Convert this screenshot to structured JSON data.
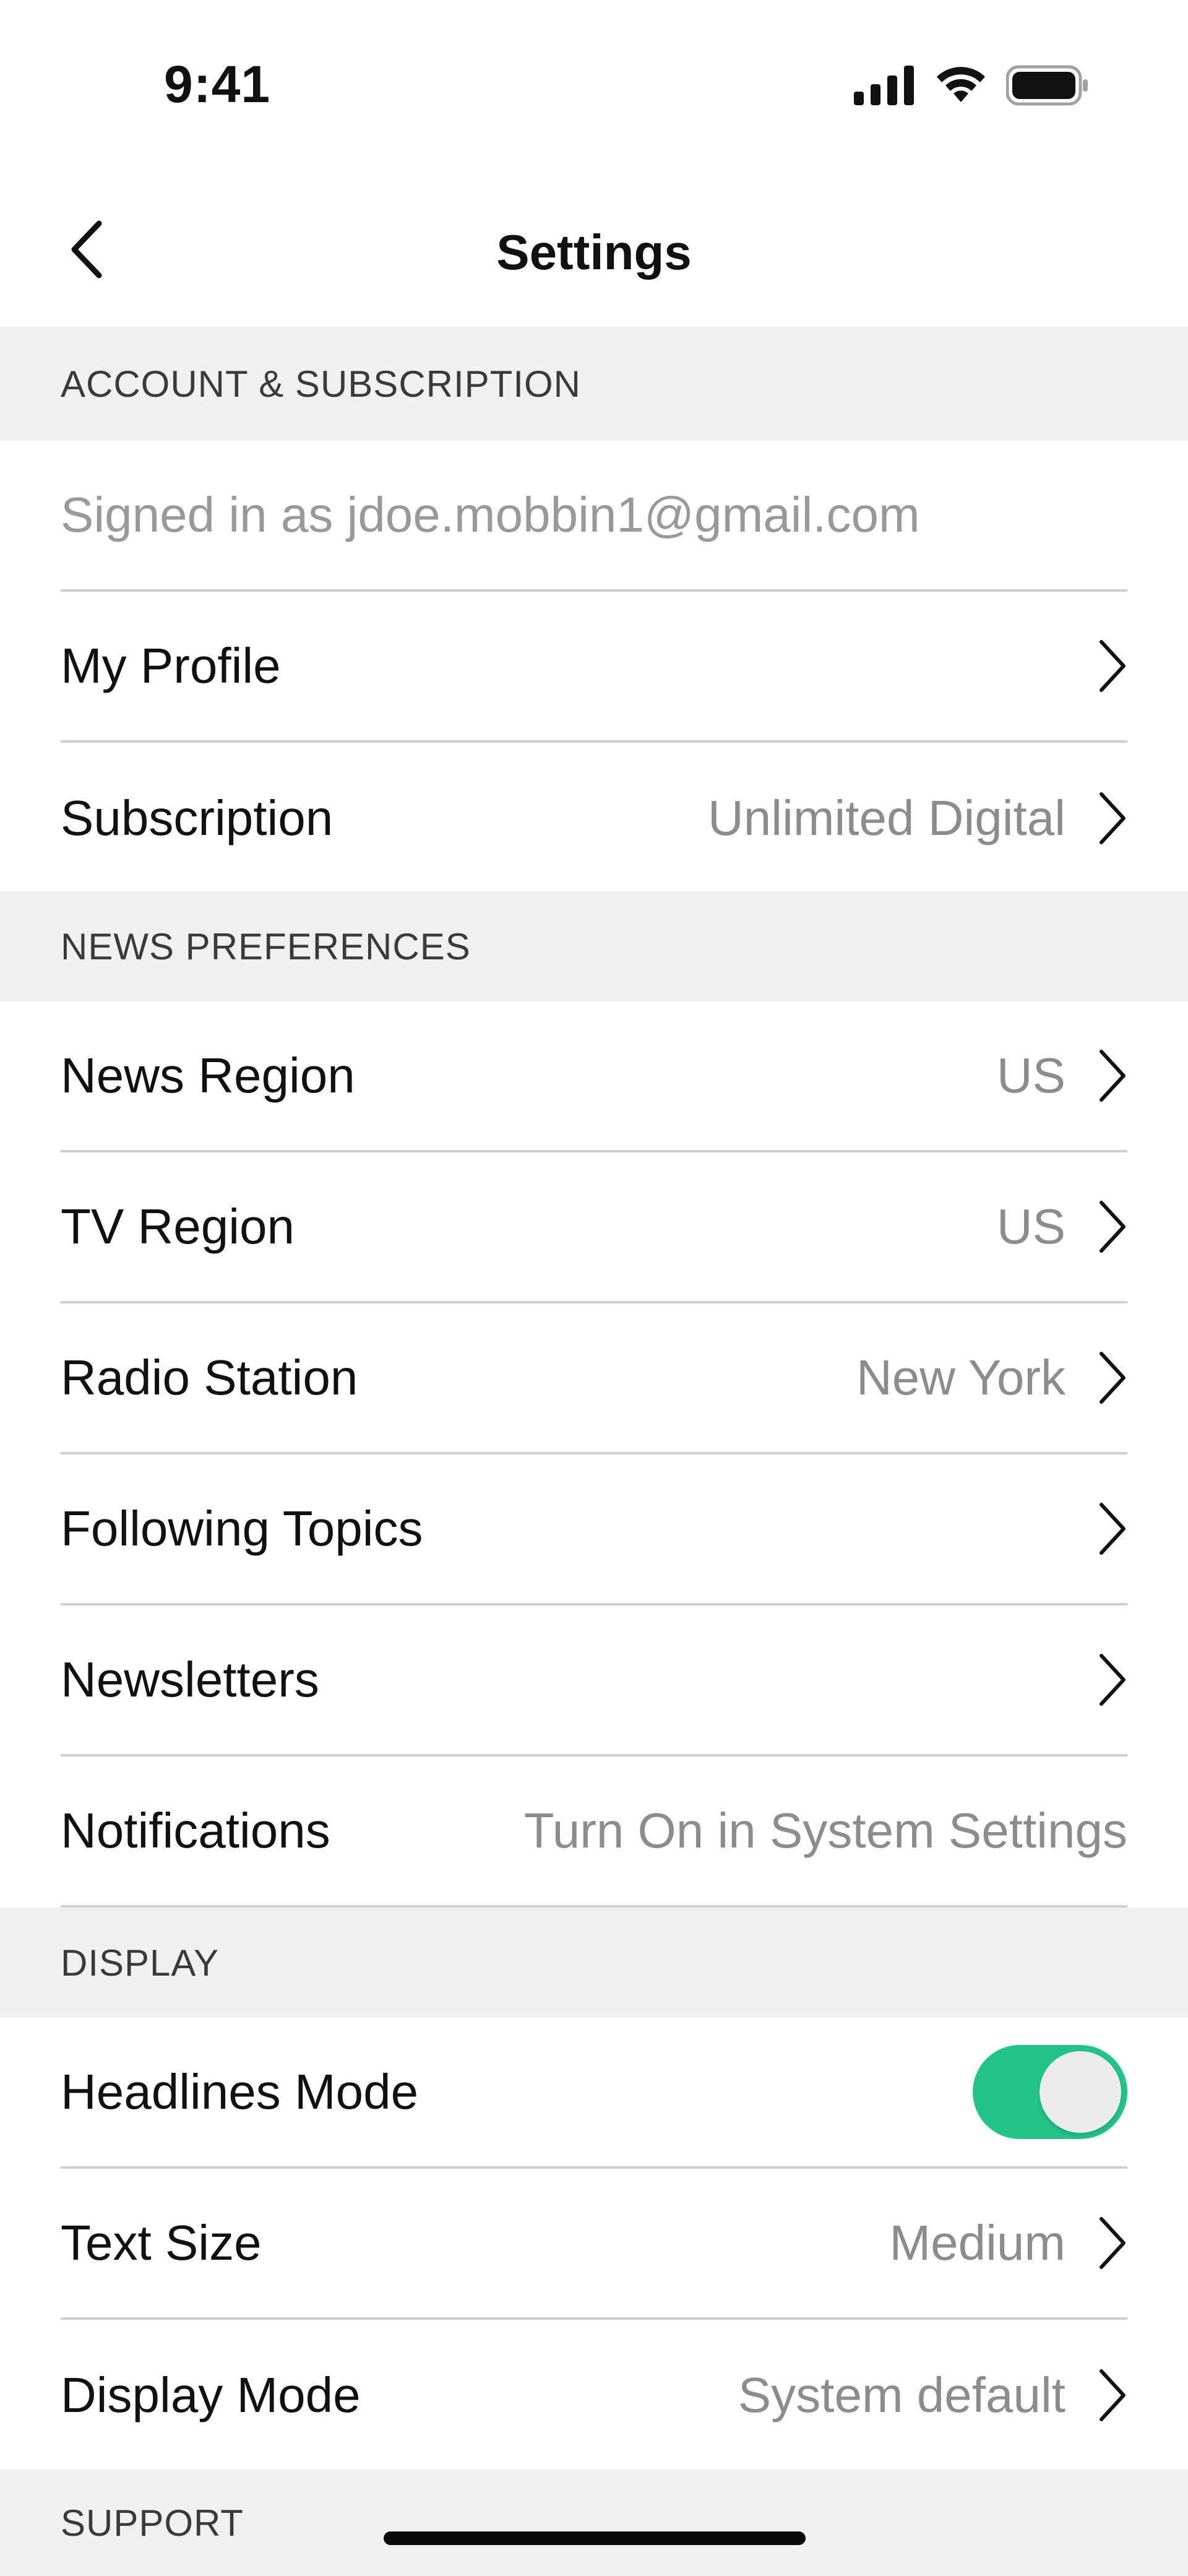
{
  "status_bar": {
    "time": "9:41",
    "icons": [
      "cellular-signal-icon",
      "wifi-icon",
      "battery-icon"
    ]
  },
  "nav": {
    "title": "Settings",
    "back_icon": "chevron-left-icon"
  },
  "sections": {
    "account": {
      "header": "ACCOUNT & SUBSCRIPTION",
      "signed_in": "Signed in as jdoe.mobbin1@gmail.com",
      "my_profile": "My Profile",
      "subscription_label": "Subscription",
      "subscription_value": "Unlimited Digital"
    },
    "news": {
      "header": "NEWS PREFERENCES",
      "news_region_label": "News Region",
      "news_region_value": "US",
      "tv_region_label": "TV Region",
      "tv_region_value": "US",
      "radio_label": "Radio Station",
      "radio_value": "New York",
      "following_label": "Following Topics",
      "newsletters_label": "Newsletters",
      "notifications_label": "Notifications",
      "notifications_value": "Turn On in System Settings"
    },
    "display": {
      "header": "DISPLAY",
      "headlines_label": "Headlines Mode",
      "headlines_on": true,
      "text_size_label": "Text Size",
      "text_size_value": "Medium",
      "display_mode_label": "Display Mode",
      "display_mode_value": "System default"
    },
    "support": {
      "header": "SUPPORT"
    }
  },
  "colors": {
    "accent_toggle": "#23c48a",
    "section_bg": "#f0f0f0",
    "muted_text": "#8c8c8c"
  }
}
